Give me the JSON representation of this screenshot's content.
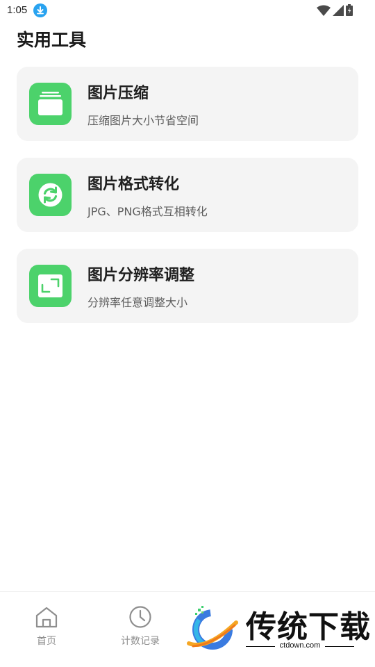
{
  "status_bar": {
    "time": "1:05"
  },
  "header": {
    "title": "实用工具"
  },
  "tools": [
    {
      "title": "图片压缩",
      "subtitle": "压缩图片大小节省空间",
      "icon": "image-stack-icon"
    },
    {
      "title": "图片格式转化",
      "subtitle": "JPG、PNG格式互相转化",
      "icon": "refresh-circle-icon"
    },
    {
      "title": "图片分辨率调整",
      "subtitle": "分辨率任意调整大小",
      "icon": "resize-corners-icon"
    }
  ],
  "bottom_nav": {
    "items": [
      {
        "label": "首页",
        "icon": "home-icon"
      },
      {
        "label": "计数记录",
        "icon": "clock-icon"
      }
    ]
  },
  "watermark": {
    "brand": "传统下载",
    "url": "ctdown.com"
  },
  "colors": {
    "accent": "#4cd26b",
    "card_bg": "#f4f4f4",
    "download_badge": "#29a3f0"
  }
}
